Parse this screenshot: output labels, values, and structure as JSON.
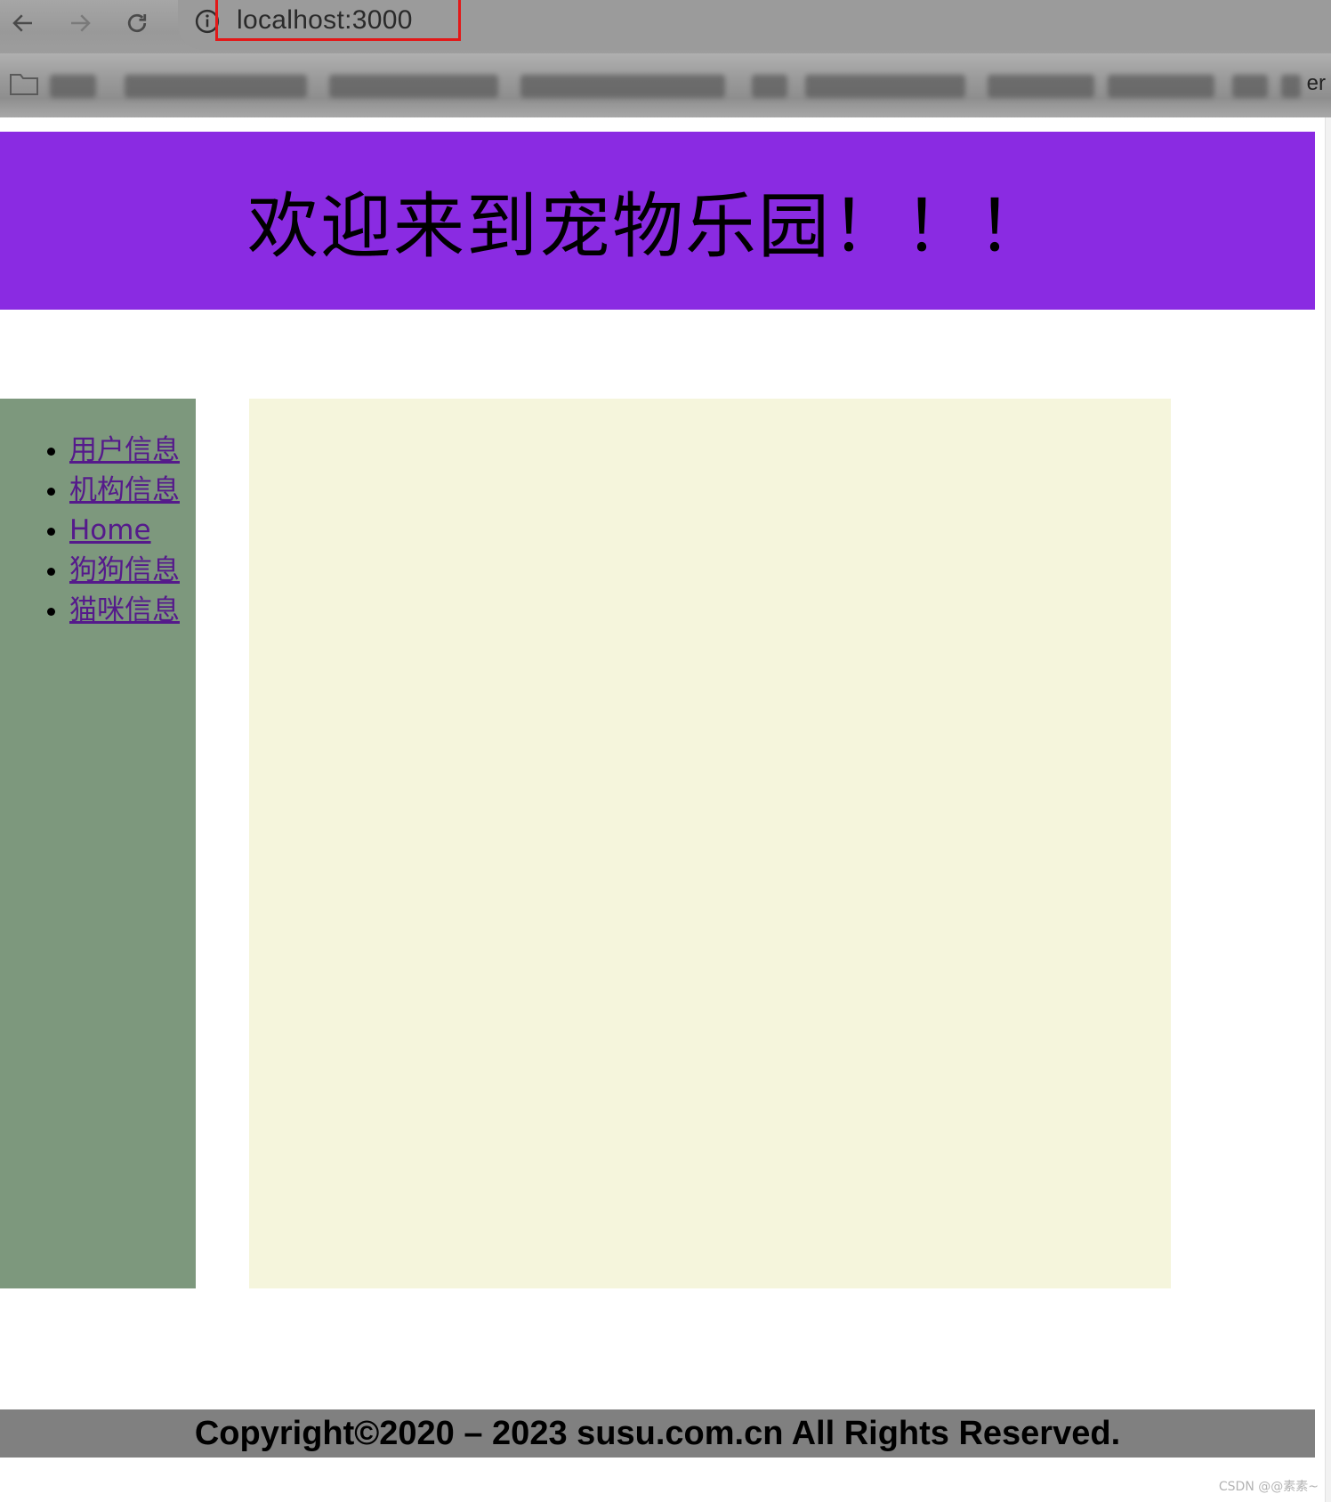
{
  "browser": {
    "url": "localhost:3000",
    "bookmark_tail_text": "er",
    "icons": {
      "back": "arrow-left-icon",
      "forward": "arrow-right-icon",
      "reload": "reload-icon",
      "site_info": "info-icon",
      "bookmark_folder": "folder-icon"
    }
  },
  "header": {
    "title": "欢迎来到宠物乐园！！！"
  },
  "sidebar": {
    "links": [
      {
        "label": "用户信息"
      },
      {
        "label": "机构信息"
      },
      {
        "label": "Home"
      },
      {
        "label": "狗狗信息"
      },
      {
        "label": "猫咪信息"
      }
    ]
  },
  "footer": {
    "copyright": "Copyright©2020 – 2023 susu.com.cn All Rights Reserved."
  },
  "watermark": "CSDN @@素素~",
  "colors": {
    "header_bg": "#8a2be2",
    "sidebar_bg": "#7d987d",
    "content_bg": "#f5f5dc",
    "footer_bg": "#808080",
    "link": "#551a8b",
    "url_highlight": "#e31818"
  }
}
